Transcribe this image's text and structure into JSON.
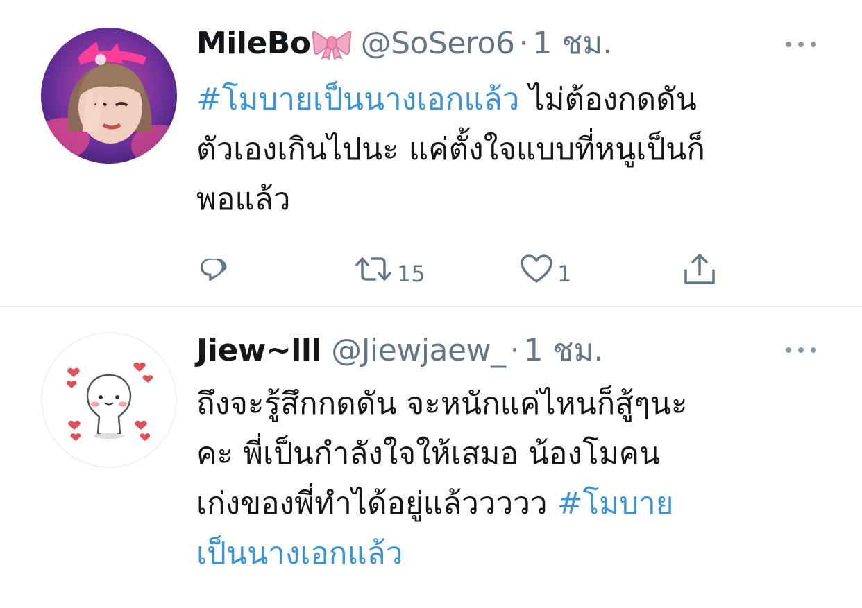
{
  "tweets": [
    {
      "display_name": "MileBo",
      "name_emoji": "ribbon-emoji",
      "handle": "@SoSero6",
      "separator": "·",
      "time": "1 ชม.",
      "body_lines": [
        {
          "hashtag": "#โมบายเป็นนางเอกแล้ว",
          "text": " ไม่ต้องกดดัน"
        },
        {
          "text": "ตัวเองเกินไปนะ แค่ตั้งใจแบบที่หนูเป็นก็"
        },
        {
          "text": "พอแล้ว"
        }
      ],
      "actions": {
        "reply_count": "",
        "retweet_count": "15",
        "like_count": "1"
      }
    },
    {
      "display_name": "Jiew~lll",
      "handle": "@Jiewjaew_",
      "separator": "·",
      "time": "1 ชม.",
      "body_lines": [
        {
          "text": "ถึงจะรู้สึกกดดัน จะหนักแค่ไหนก็สู้ๆนะ"
        },
        {
          "text": "คะ พี่เป็นกำลังใจให้เสมอ น้องโมคน"
        },
        {
          "text": "เก่งของพี่ทำได้อยู่แล้ววววว ",
          "hashtag": "#โมบาย"
        },
        {
          "hashtag": "เป็นนางเอกแล้ว"
        }
      ]
    }
  ],
  "colors": {
    "link": "#3b94d9",
    "secondary_text": "#657786",
    "divider": "#e1e8ed",
    "avatar_1_accent": "#e0488f"
  },
  "icons": {
    "more": "more-horizontal-icon",
    "reply": "reply-icon",
    "retweet": "retweet-icon",
    "like": "heart-icon",
    "share": "share-icon"
  }
}
